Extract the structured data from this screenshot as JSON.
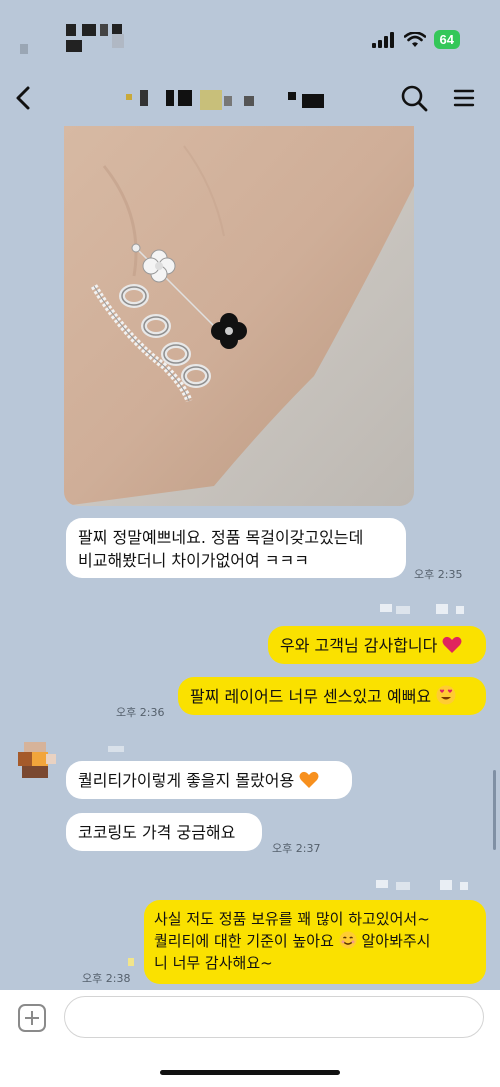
{
  "status_bar": {
    "battery": "64"
  },
  "messages": {
    "m1": {
      "text_line1": "팔찌 정말예쁘네요. 정품 목걸이갖고있는데",
      "text_line2": "비교해봤더니 차이가없어여 ㅋㅋㅋ",
      "time": "오후 2:35"
    },
    "m2": {
      "text": "우와 고객님 감사합니다"
    },
    "m3": {
      "text": "팔찌 레이어드 너무 센스있고 예뻐요",
      "time": "오후 2:36"
    },
    "m4": {
      "text": "퀄리티가이렇게 좋을지 몰랐어용"
    },
    "m5": {
      "text": "코코링도 가격 궁금해요",
      "time": "오후 2:37"
    },
    "m6": {
      "text_line1": "사실 저도 정품 보유를 꽤 많이 하고있어서~",
      "text_line2_a": "퀄리티에 대한 기준이 높아요",
      "text_line2_b": "알아봐주시",
      "text_line3": "니 너무 감사해요~",
      "time": "오후 2:38"
    }
  },
  "input": {
    "placeholder": ""
  },
  "icons": {
    "back": "chevron-left-icon",
    "search": "search-icon",
    "menu": "hamburger-menu-icon",
    "add": "plus-icon",
    "heart": "red-heart-emoji",
    "heart_eyes": "heart-eyes-emoji",
    "orange_heart": "orange-heart-emoji",
    "smile": "smiling-face-emoji"
  },
  "colors": {
    "background": "#b9c7d8",
    "my_bubble": "#fae100",
    "their_bubble": "#ffffff",
    "battery": "#34c759"
  }
}
